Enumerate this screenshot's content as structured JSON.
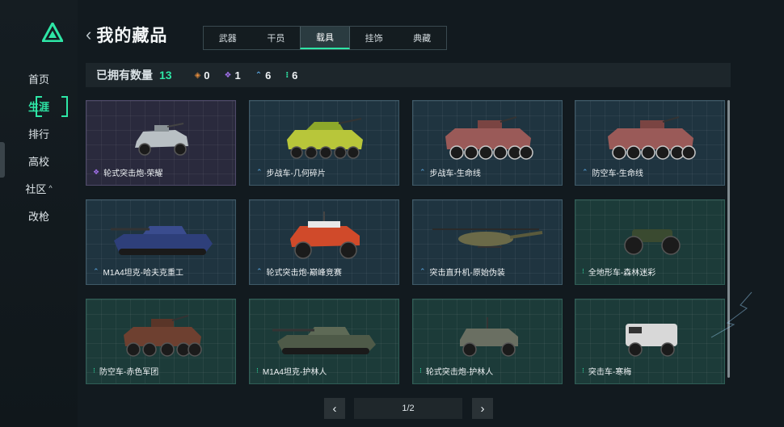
{
  "nav": {
    "items": [
      {
        "label": "首页",
        "caret": ""
      },
      {
        "label": "生涯",
        "caret": ""
      },
      {
        "label": "排行",
        "caret": ""
      },
      {
        "label": "高校",
        "caret": ""
      },
      {
        "label": "社区",
        "caret": "^"
      },
      {
        "label": "改枪",
        "caret": ""
      }
    ],
    "active_index": 1
  },
  "header": {
    "back": "‹",
    "title": "我的藏品"
  },
  "tabs": [
    {
      "label": "武器"
    },
    {
      "label": "干员"
    },
    {
      "label": "载具"
    },
    {
      "label": "挂饰"
    },
    {
      "label": "典藏"
    }
  ],
  "active_tab": 2,
  "summary": {
    "label": "已拥有数量",
    "total": "13",
    "rarities": [
      {
        "icon": "orange-diamond-icon",
        "glyph": "◈",
        "color": "#e08a3c",
        "count": "0"
      },
      {
        "icon": "purple-diamond-icon",
        "glyph": "❖",
        "color": "#a070e8",
        "count": "1"
      },
      {
        "icon": "blue-chevron-icon",
        "glyph": "⌃",
        "color": "#5aa6e0",
        "count": "6"
      },
      {
        "icon": "green-dots-icon",
        "glyph": "⁝",
        "color": "#2ee6a6",
        "count": "6"
      }
    ]
  },
  "cards": [
    {
      "name": "轮式突击炮-荣耀",
      "rarity": "purple",
      "glyph": "❖",
      "color": "#a070e8",
      "vehicle": "armored-car"
    },
    {
      "name": "步战车-几何碎片",
      "rarity": "blue",
      "glyph": "⌃",
      "color": "#5aa6e0",
      "vehicle": "ifv-yellow"
    },
    {
      "name": "步战车-生命线",
      "rarity": "blue",
      "glyph": "⌃",
      "color": "#5aa6e0",
      "vehicle": "apc-red"
    },
    {
      "name": "防空车-生命线",
      "rarity": "blue",
      "glyph": "⌃",
      "color": "#5aa6e0",
      "vehicle": "apc-red"
    },
    {
      "name": "M1A4坦克-哈夫克重工",
      "rarity": "blue",
      "glyph": "⌃",
      "color": "#5aa6e0",
      "vehicle": "tank-blue"
    },
    {
      "name": "轮式突击炮-巅峰竞赛",
      "rarity": "blue",
      "glyph": "⌃",
      "color": "#5aa6e0",
      "vehicle": "buggy-red"
    },
    {
      "name": "突击直升机-原始伪装",
      "rarity": "blue",
      "glyph": "⌃",
      "color": "#5aa6e0",
      "vehicle": "helicopter"
    },
    {
      "name": "全地形车-森林迷彩",
      "rarity": "green",
      "glyph": "⁝",
      "color": "#2ee6a6",
      "vehicle": "atv"
    },
    {
      "name": "防空车-赤色军团",
      "rarity": "green",
      "glyph": "⁝",
      "color": "#2ee6a6",
      "vehicle": "apc-camo"
    },
    {
      "name": "M1A4坦克-护林人",
      "rarity": "green",
      "glyph": "⁝",
      "color": "#2ee6a6",
      "vehicle": "tank-camo"
    },
    {
      "name": "轮式突击炮-护林人",
      "rarity": "green",
      "glyph": "⁝",
      "color": "#2ee6a6",
      "vehicle": "humvee-camo"
    },
    {
      "name": "突击车-寒梅",
      "rarity": "green",
      "glyph": "⁝",
      "color": "#2ee6a6",
      "vehicle": "truck-white"
    }
  ],
  "pagination": {
    "prev": "‹",
    "next": "›",
    "page": "1/2"
  }
}
